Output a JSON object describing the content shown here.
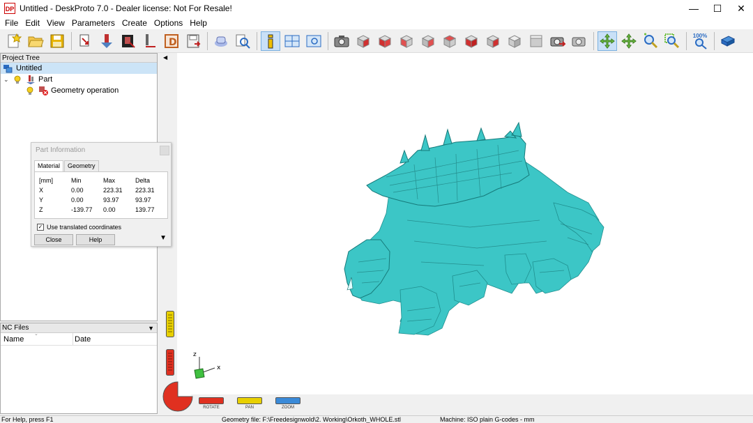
{
  "window": {
    "logo_text": "DP",
    "title": "Untitled - DeskProto 7.0 - Dealer license: Not For Resale!",
    "minimize_glyph": "—",
    "maximize_glyph": "☐",
    "close_glyph": "✕"
  },
  "menu": {
    "items": [
      "File",
      "Edit",
      "View",
      "Parameters",
      "Create",
      "Options",
      "Help"
    ]
  },
  "toolbar": {
    "zoom_text": "100%",
    "icons": [
      "new-project-icon",
      "open-project-icon",
      "save-project-icon",
      "import-geometry-icon",
      "operation-wizard-icon",
      "part-parameters-icon",
      "cutter-icon",
      "drawing-icon",
      "save-as-icon",
      "simulation-icon",
      "inspect-icon",
      "info-icon",
      "layout-icon",
      "zoom-window-icon",
      "screenshot-icon",
      "view-front-icon",
      "view-back-icon",
      "view-left-icon",
      "view-right-icon",
      "view-top-icon",
      "view-bottom-icon",
      "view-iso-icon",
      "view-iso2-icon",
      "refresh-view-icon",
      "render-settings-icon",
      "rotate-view-icon",
      "pan-view-icon",
      "zoom-in-icon",
      "zoom-fit-icon",
      "zoom-100-icon",
      "help-book-icon"
    ]
  },
  "project_tree": {
    "header": "Project Tree",
    "items": [
      {
        "label": "Untitled"
      },
      {
        "label": "Part"
      },
      {
        "label": "Geometry operation"
      }
    ]
  },
  "nc_files": {
    "header": "NC Files",
    "columns": [
      "Name",
      "Date"
    ]
  },
  "part_info": {
    "title": "Part Information",
    "tabs": [
      "Material",
      "Geometry"
    ],
    "headers": [
      "[mm]",
      "Min",
      "Max",
      "Delta"
    ],
    "rows": [
      {
        "axis": "X",
        "min": "0.00",
        "max": "223.31",
        "delta": "223.31"
      },
      {
        "axis": "Y",
        "min": "0.00",
        "max": "93.97",
        "delta": "93.97"
      },
      {
        "axis": "Z",
        "min": "-139.77",
        "max": "0.00",
        "delta": "139.77"
      }
    ],
    "use_translated": "Use translated coordinates",
    "use_translated_checked": true,
    "close_label": "Close",
    "help_label": "Help"
  },
  "viewport": {
    "model_color": "#3cc6c6",
    "axis_x": "x",
    "axis_z": "z"
  },
  "controls": {
    "rotate_label": "ROTATE",
    "pan_label": "PAN",
    "zoom_label": "ZOOM"
  },
  "statusbar": {
    "help": "For Help, press F1",
    "geometry_file": "Geometry file: F:\\Freedesignwold\\2. Working\\Orkoth_WHOLE.stl",
    "machine": "Machine: ISO plain G-codes - mm"
  }
}
